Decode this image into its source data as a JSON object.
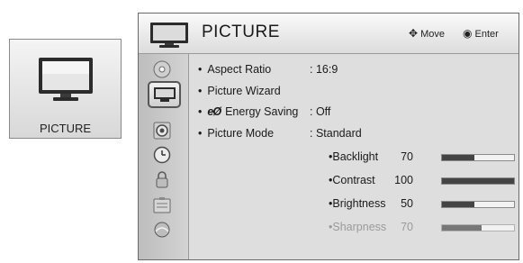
{
  "thumbnail": {
    "label": "PICTURE"
  },
  "header": {
    "title": "PICTURE",
    "move_hint": "Move",
    "enter_hint": "Enter"
  },
  "sidebar": {
    "icons": [
      {
        "name": "disc-icon"
      },
      {
        "name": "tv-picture-icon",
        "selected": true
      },
      {
        "name": "speaker-icon"
      },
      {
        "name": "clock-icon"
      },
      {
        "name": "lock-icon"
      },
      {
        "name": "options-icon"
      },
      {
        "name": "network-icon"
      }
    ]
  },
  "menu": {
    "items": [
      {
        "label": "Aspect Ratio",
        "value": ": 16:9"
      },
      {
        "label": "Picture Wizard",
        "value": ""
      },
      {
        "label": "Energy Saving",
        "value": ": Off",
        "icon_text": "eØ"
      },
      {
        "label": "Picture Mode",
        "value": ": Standard"
      }
    ],
    "sub_items": [
      {
        "label": "Backlight",
        "value": "70",
        "level": 0.45
      },
      {
        "label": "Contrast",
        "value": "100",
        "level": 1.0
      },
      {
        "label": "Brightness",
        "value": "50",
        "level": 0.45
      },
      {
        "label": "Sharpness",
        "value": "70",
        "level": 0.55
      }
    ]
  },
  "bullet": "•"
}
